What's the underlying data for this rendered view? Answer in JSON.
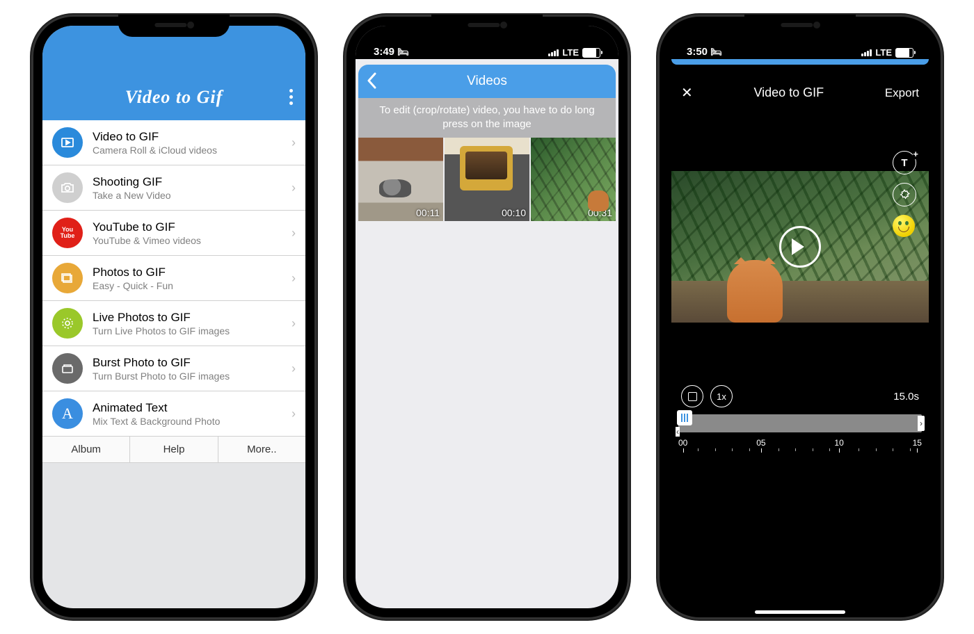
{
  "phone1": {
    "app_title": "Video to Gif",
    "menu": [
      {
        "title": "Video to GIF",
        "subtitle": "Camera Roll & iCloud videos",
        "icon": "video-play-icon",
        "color": "#2a8adb"
      },
      {
        "title": "Shooting GIF",
        "subtitle": "Take a New Video",
        "icon": "camera-icon",
        "color": "#cfcfcf"
      },
      {
        "title": "YouTube to GIF",
        "subtitle": "YouTube & Vimeo videos",
        "icon": "youtube-icon",
        "color": "#e02018"
      },
      {
        "title": "Photos to GIF",
        "subtitle": "Easy - Quick - Fun",
        "icon": "photos-icon",
        "color": "#e8a838"
      },
      {
        "title": "Live Photos to GIF",
        "subtitle": "Turn Live Photos to GIF images",
        "icon": "live-photo-icon",
        "color": "#9ac82a"
      },
      {
        "title": "Burst Photo to GIF",
        "subtitle": "Turn Burst Photo to GIF images",
        "icon": "burst-icon",
        "color": "#6a6a6a"
      },
      {
        "title": "Animated Text",
        "subtitle": "Mix Text & Background Photo",
        "icon": "text-icon",
        "color": "#3a8ee0"
      }
    ],
    "tabs": [
      "Album",
      "Help",
      "More.."
    ]
  },
  "phone2": {
    "status_time": "3:49",
    "status_net": "LTE",
    "header": "Videos",
    "hint": "To edit (crop/rotate) video, you have to do long press on the image",
    "videos": [
      {
        "duration": "00:11"
      },
      {
        "duration": "00:10"
      },
      {
        "duration": "00:31"
      }
    ]
  },
  "phone3": {
    "status_time": "3:50",
    "status_net": "LTE",
    "title": "Video to GIF",
    "export": "Export",
    "speed": "1x",
    "duration": "15.0s",
    "ticks": [
      "00",
      "05",
      "10",
      "15"
    ]
  }
}
